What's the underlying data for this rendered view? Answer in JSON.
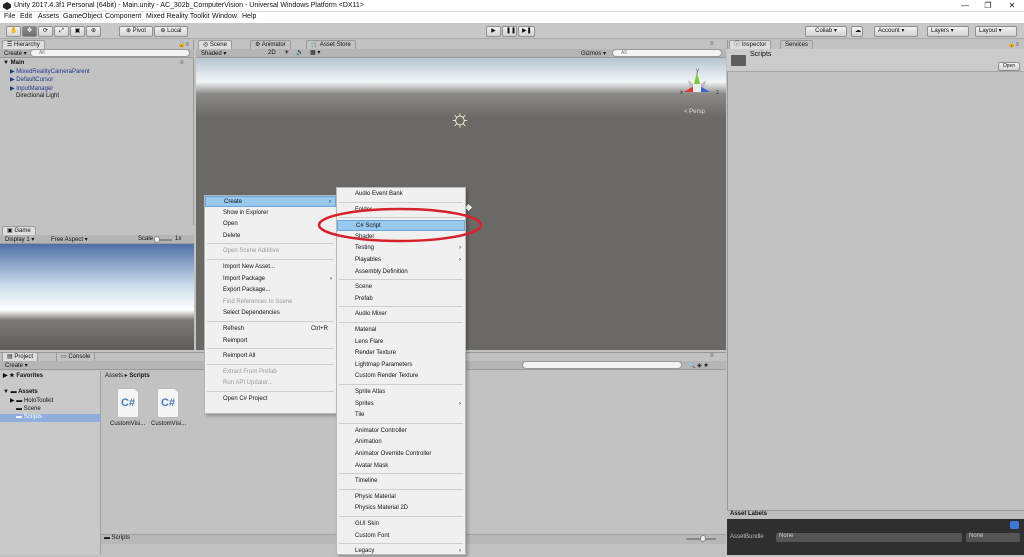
{
  "window": {
    "title": "Unity 2017.4.3f1 Personal (64bit) - Main.unity - AC_302b_ComputerVision - Universal Windows Platform <DX11>",
    "controls": [
      "—",
      "❐",
      "✕"
    ]
  },
  "menubar": [
    "File",
    "Edit",
    "Assets",
    "GameObject",
    "Component",
    "Mixed Reality Toolkit",
    "Window",
    "Help"
  ],
  "toolbar": {
    "pivot": "Pivot",
    "local": "Local",
    "collab": "Collab ▾",
    "account": "Account",
    "layers": "Layers",
    "layout": "Layout"
  },
  "hierarchy": {
    "tab": "Hierarchy",
    "create": "Create ▾",
    "search": "All",
    "scene": "Main",
    "items": [
      "MixedRealityCameraParent",
      "DefaultCursor",
      "InputManager",
      "Directional Light"
    ]
  },
  "scene": {
    "tabs": [
      "Scene",
      "Animator",
      "Asset Store"
    ],
    "shaded": "Shaded",
    "twod": "2D",
    "gizmos": "Gizmos ▾",
    "search": "All",
    "persp": "< Persp",
    "axes": [
      "y",
      "x",
      "z"
    ]
  },
  "game": {
    "tab": "Game",
    "display": "Display 1",
    "aspect": "Free Aspect",
    "scale": "Scale",
    "scale_val": "1x"
  },
  "project": {
    "tabs": [
      "Project",
      "Console"
    ],
    "create": "Create ▾",
    "favorites": "Favorites",
    "assets": "Assets",
    "folders": [
      "HoloToolkit",
      "Scene",
      "Scripts"
    ],
    "breadcrumb": [
      "Assets",
      "Scripts"
    ],
    "files": [
      {
        "name": "CustomVisi..."
      },
      {
        "name": "CustomVisi..."
      }
    ],
    "footer": "Scripts"
  },
  "inspector": {
    "tabs": [
      "Inspector",
      "Services"
    ],
    "title": "Scripts",
    "open": "Open",
    "asset_labels": "Asset Labels",
    "asset_bundle": "AssetBundle",
    "ab_val": "None",
    "ab_variant": "None"
  },
  "context_menu": {
    "items": [
      {
        "label": "Create",
        "sub": true,
        "hi": true
      },
      {
        "label": "Show in Explorer"
      },
      {
        "label": "Open"
      },
      {
        "label": "Delete"
      },
      {
        "label": "Open Scene Additive",
        "dis": true,
        "sep": true
      },
      {
        "label": "Import New Asset...",
        "sep": true
      },
      {
        "label": "Import Package",
        "sub": true
      },
      {
        "label": "Export Package..."
      },
      {
        "label": "Find References In Scene",
        "dis": true
      },
      {
        "label": "Select Dependencies"
      },
      {
        "label": "Refresh",
        "sep": true,
        "shortcut": "Ctrl+R"
      },
      {
        "label": "Reimport"
      },
      {
        "label": "Reimport All",
        "sep": true
      },
      {
        "label": "Extract From Prefab",
        "dis": true,
        "sep": true
      },
      {
        "label": "Run API Updater...",
        "dis": true
      },
      {
        "label": "Open C# Project",
        "sep": true
      }
    ]
  },
  "create_submenu": {
    "items": [
      {
        "label": "Audio Event Bank"
      },
      {
        "label": "Folder",
        "sep": true
      },
      {
        "label": "C# Script",
        "hi": true,
        "sep": true
      },
      {
        "label": "Shader",
        "sub": true
      },
      {
        "label": "Testing",
        "sub": true
      },
      {
        "label": "Playables",
        "sub": true
      },
      {
        "label": "Assembly Definition"
      },
      {
        "label": "Scene",
        "sep": true
      },
      {
        "label": "Prefab"
      },
      {
        "label": "Audio Mixer",
        "sep": true
      },
      {
        "label": "Material",
        "sep": true
      },
      {
        "label": "Lens Flare"
      },
      {
        "label": "Render Texture"
      },
      {
        "label": "Lightmap Parameters"
      },
      {
        "label": "Custom Render Texture"
      },
      {
        "label": "Sprite Atlas",
        "sep": true
      },
      {
        "label": "Sprites",
        "sub": true
      },
      {
        "label": "Tile"
      },
      {
        "label": "Animator Controller",
        "sep": true
      },
      {
        "label": "Animation"
      },
      {
        "label": "Animator Override Controller"
      },
      {
        "label": "Avatar Mask"
      },
      {
        "label": "Timeline",
        "sep": true
      },
      {
        "label": "Physic Material",
        "sep": true
      },
      {
        "label": "Physics Material 2D"
      },
      {
        "label": "GUI Skin",
        "sep": true
      },
      {
        "label": "Custom Font"
      },
      {
        "label": "Legacy",
        "sep": true,
        "sub": true
      }
    ]
  },
  "colors": {
    "highlight": "#99c9ef",
    "annotation": "#d6202a",
    "scene_grey": "#6b6966",
    "sky": "#c7d8e6"
  }
}
